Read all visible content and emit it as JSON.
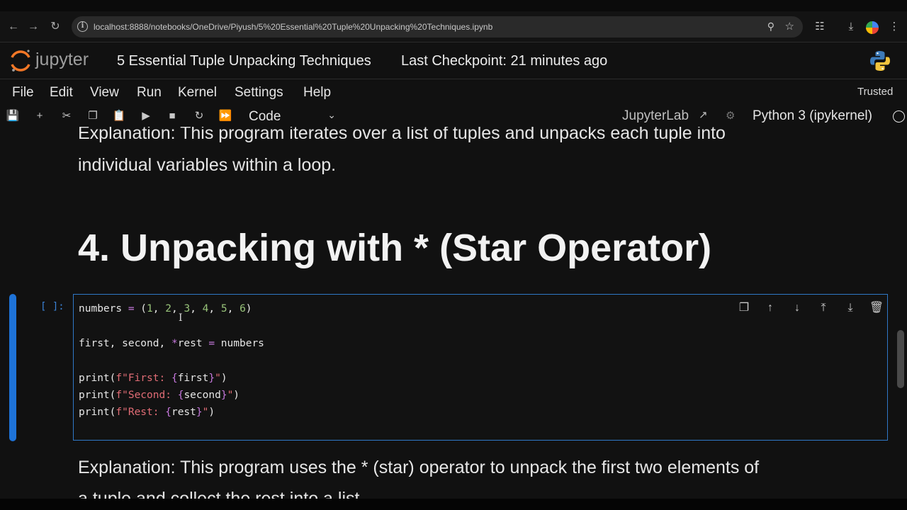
{
  "browser": {
    "url": "localhost:8888/notebooks/OneDrive/Piyush/5%20Essential%20Tuple%20Unpacking%20Techniques.ipynb"
  },
  "header": {
    "logo_text": "jupyter",
    "notebook_title": "5 Essential Tuple Unpacking Techniques",
    "checkpoint": "Last Checkpoint: 21 minutes ago"
  },
  "menu": {
    "items": [
      "File",
      "Edit",
      "View",
      "Run",
      "Kernel",
      "Settings",
      "Help"
    ],
    "trusted": "Trusted"
  },
  "toolbar": {
    "cell_type": "Code",
    "jupyterlab_link": "JupyterLab",
    "kernel_name": "Python 3 (ipykernel)"
  },
  "notebook": {
    "md_prev_line1": "Explanation: This program iterates over a list of tuples and unpacks each tuple into",
    "md_prev_line2": "individual variables within a loop.",
    "heading": "4. Unpacking with * (Star Operator)",
    "cell_prompt": "[ ]:",
    "md_next_line1": "Explanation: This program uses the * (star) operator to unpack the first two elements of",
    "md_next_line2": "a tuple and collect the rest into a list."
  },
  "code_cell": {
    "lines": [
      "numbers = (1, 2, 3, 4, 5, 6)",
      "",
      "first, second, *rest = numbers",
      "",
      "print(f\"First: {first}\")",
      "print(f\"Second: {second}\")",
      "print(f\"Rest: {rest}\")"
    ]
  },
  "colors": {
    "active_cell": "#1e73d8",
    "keyword_op": "#c678dd",
    "number": "#98c379",
    "string": "#e06c75"
  }
}
